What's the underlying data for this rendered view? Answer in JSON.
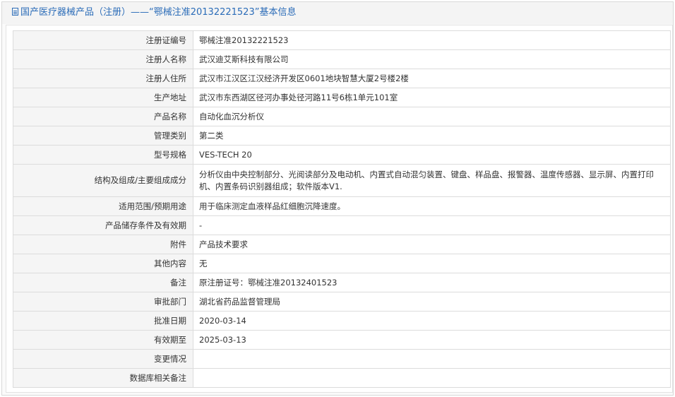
{
  "header": {
    "icon": "document-icon",
    "title": "国产医疗器械产品（注册）——“鄂械注准20132221523”基本信息"
  },
  "rows": [
    {
      "label": "注册证编号",
      "value": "鄂械注准20132221523"
    },
    {
      "label": "注册人名称",
      "value": "武汉迪艾斯科技有限公司"
    },
    {
      "label": "注册人住所",
      "value": "武汉市江汉区江汉经济开发区0601地块智慧大厦2号楼2楼"
    },
    {
      "label": "生产地址",
      "value": "武汉市东西湖区径河办事处径河路11号6栋1单元101室"
    },
    {
      "label": "产品名称",
      "value": "自动化血沉分析仪"
    },
    {
      "label": "管理类别",
      "value": "第二类"
    },
    {
      "label": "型号规格",
      "value": "VES-TECH 20"
    },
    {
      "label": "结构及组成/主要组成成分",
      "value": "分析仪由中央控制部分、光阅读部分及电动机、内置式自动混匀装置、键盘、样品盘、报警器、温度传感器、显示屏、内置打印机、内置条码识别器组成；软件版本V1."
    },
    {
      "label": "适用范围/预期用途",
      "value": "用于临床测定血液样品红细胞沉降速度。"
    },
    {
      "label": "产品储存条件及有效期",
      "value": "-"
    },
    {
      "label": "附件",
      "value": "产品技术要求"
    },
    {
      "label": "其他内容",
      "value": "无"
    },
    {
      "label": "备注",
      "value": "原注册证号：鄂械注准20132401523"
    },
    {
      "label": "审批部门",
      "value": "湖北省药品监督管理局"
    },
    {
      "label": "批准日期",
      "value": "2020-03-14"
    },
    {
      "label": "有效期至",
      "value": "2025-03-13"
    },
    {
      "label": "变更情况",
      "value": ""
    },
    {
      "label": "数据库相关备注",
      "value": ""
    }
  ]
}
